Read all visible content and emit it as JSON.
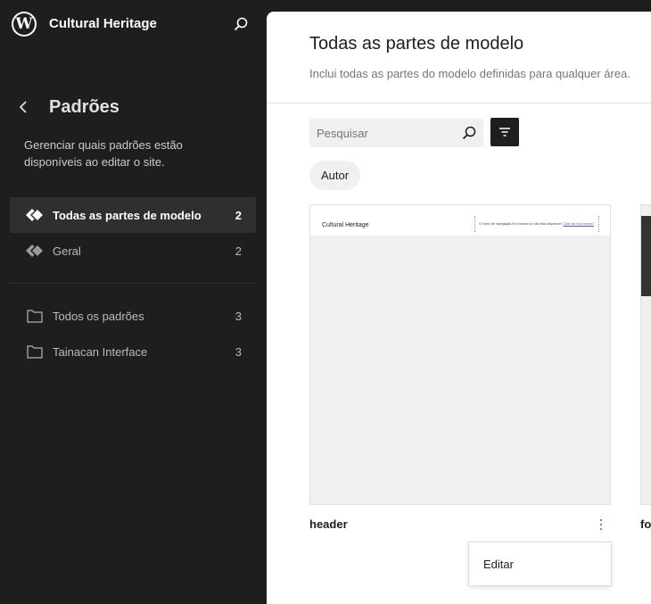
{
  "site": {
    "title": "Cultural Heritage"
  },
  "sidebar": {
    "title": "Padrões",
    "description": "Gerenciar quais padrões estão disponíveis ao editar o site.",
    "items": [
      {
        "label": "Todas as partes de modelo",
        "count": "2",
        "icon": "symbol-icon",
        "active": true
      },
      {
        "label": "Geral",
        "count": "2",
        "icon": "symbol-icon",
        "active": false
      },
      {
        "label": "Todos os padrões",
        "count": "3",
        "icon": "folder-icon",
        "active": false
      },
      {
        "label": "Tainacan Interface",
        "count": "3",
        "icon": "folder-icon",
        "active": false
      }
    ]
  },
  "main": {
    "title": "Todas as partes de modelo",
    "description": "Inclui todas as partes do modelo definidas para qualquer área.",
    "search": {
      "placeholder": "Pesquisar"
    },
    "filter_chip": "Autor",
    "cards": [
      {
        "name": "header",
        "preview_title": "Cultural Heritage",
        "preview_note": "O menu de navegação foi excluído ou não está disponível.",
        "preview_link": "Criar um novo menu?"
      },
      {
        "name": "fo"
      }
    ],
    "menu": {
      "item": "Editar"
    }
  },
  "colors": {
    "accent": "#3858e9",
    "sidebar_bg": "#1e1e1e",
    "active_item_bg": "#2f2f2f"
  }
}
